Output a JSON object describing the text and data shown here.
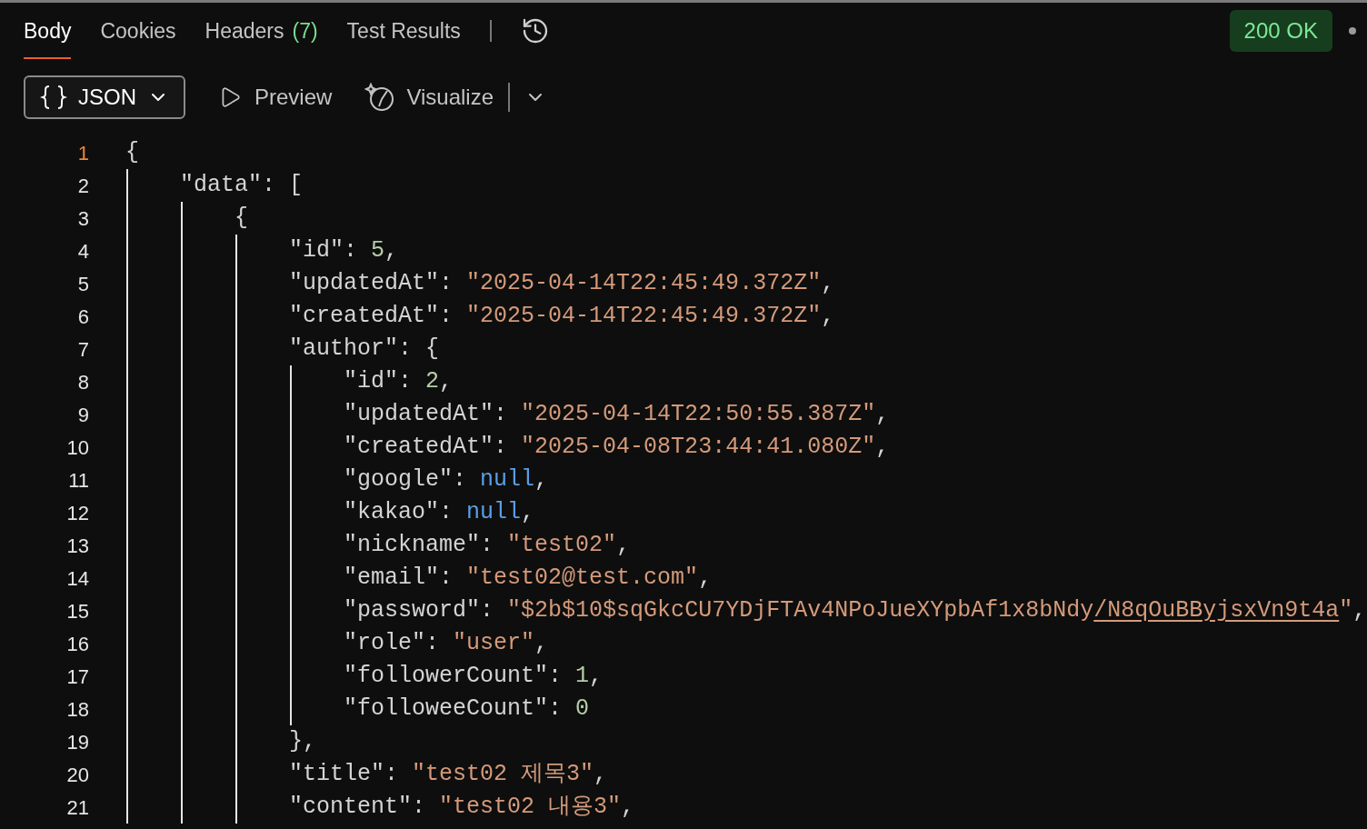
{
  "tabs": [
    {
      "label": "Body",
      "selected": true
    },
    {
      "label": "Cookies",
      "selected": false
    },
    {
      "label": "Headers",
      "count": "(7)",
      "selected": false
    },
    {
      "label": "Test Results",
      "selected": false
    }
  ],
  "status": {
    "text": "200 OK"
  },
  "toolbar": {
    "format": "JSON",
    "preview": "Preview",
    "visualize": "Visualize"
  },
  "code_lines": [
    {
      "number": "1",
      "current": true,
      "tokens": [
        {
          "kind": "punct",
          "text": "{"
        }
      ]
    },
    {
      "number": "2",
      "current": false,
      "tokens": [
        {
          "kind": "key",
          "text": "    \"data\""
        },
        {
          "kind": "punct",
          "text": ": ["
        }
      ]
    },
    {
      "number": "3",
      "current": false,
      "tokens": [
        {
          "kind": "punct",
          "text": "        {"
        }
      ]
    },
    {
      "number": "4",
      "current": false,
      "tokens": [
        {
          "kind": "key",
          "text": "            \"id\""
        },
        {
          "kind": "punct",
          "text": ": "
        },
        {
          "kind": "number",
          "text": "5"
        },
        {
          "kind": "punct",
          "text": ","
        }
      ]
    },
    {
      "number": "5",
      "current": false,
      "tokens": [
        {
          "kind": "key",
          "text": "            \"updatedAt\""
        },
        {
          "kind": "punct",
          "text": ": "
        },
        {
          "kind": "string",
          "text": "\"2025-04-14T22:45:49.372Z\""
        },
        {
          "kind": "punct",
          "text": ","
        }
      ]
    },
    {
      "number": "6",
      "current": false,
      "tokens": [
        {
          "kind": "key",
          "text": "            \"createdAt\""
        },
        {
          "kind": "punct",
          "text": ": "
        },
        {
          "kind": "string",
          "text": "\"2025-04-14T22:45:49.372Z\""
        },
        {
          "kind": "punct",
          "text": ","
        }
      ]
    },
    {
      "number": "7",
      "current": false,
      "tokens": [
        {
          "kind": "key",
          "text": "            \"author\""
        },
        {
          "kind": "punct",
          "text": ": {"
        }
      ]
    },
    {
      "number": "8",
      "current": false,
      "tokens": [
        {
          "kind": "key",
          "text": "                \"id\""
        },
        {
          "kind": "punct",
          "text": ": "
        },
        {
          "kind": "number",
          "text": "2"
        },
        {
          "kind": "punct",
          "text": ","
        }
      ]
    },
    {
      "number": "9",
      "current": false,
      "tokens": [
        {
          "kind": "key",
          "text": "                \"updatedAt\""
        },
        {
          "kind": "punct",
          "text": ": "
        },
        {
          "kind": "string",
          "text": "\"2025-04-14T22:50:55.387Z\""
        },
        {
          "kind": "punct",
          "text": ","
        }
      ]
    },
    {
      "number": "10",
      "current": false,
      "tokens": [
        {
          "kind": "key",
          "text": "                \"createdAt\""
        },
        {
          "kind": "punct",
          "text": ": "
        },
        {
          "kind": "string",
          "text": "\"2025-04-08T23:44:41.080Z\""
        },
        {
          "kind": "punct",
          "text": ","
        }
      ]
    },
    {
      "number": "11",
      "current": false,
      "tokens": [
        {
          "kind": "key",
          "text": "                \"google\""
        },
        {
          "kind": "punct",
          "text": ": "
        },
        {
          "kind": "null",
          "text": "null"
        },
        {
          "kind": "punct",
          "text": ","
        }
      ]
    },
    {
      "number": "12",
      "current": false,
      "tokens": [
        {
          "kind": "key",
          "text": "                \"kakao\""
        },
        {
          "kind": "punct",
          "text": ": "
        },
        {
          "kind": "null",
          "text": "null"
        },
        {
          "kind": "punct",
          "text": ","
        }
      ]
    },
    {
      "number": "13",
      "current": false,
      "tokens": [
        {
          "kind": "key",
          "text": "                \"nickname\""
        },
        {
          "kind": "punct",
          "text": ": "
        },
        {
          "kind": "string",
          "text": "\"test02\""
        },
        {
          "kind": "punct",
          "text": ","
        }
      ]
    },
    {
      "number": "14",
      "current": false,
      "tokens": [
        {
          "kind": "key",
          "text": "                \"email\""
        },
        {
          "kind": "punct",
          "text": ": "
        },
        {
          "kind": "string",
          "text": "\"test02@test.com\""
        },
        {
          "kind": "punct",
          "text": ","
        }
      ]
    },
    {
      "number": "15",
      "current": false,
      "tokens": [
        {
          "kind": "key",
          "text": "                \"password\""
        },
        {
          "kind": "punct",
          "text": ": "
        },
        {
          "kind": "string",
          "text": "\"$2b$10$sqGkcCU7YDjFTAv4NPoJueXYpbAf1x8bNdy"
        },
        {
          "kind": "link",
          "text": "/N8qOuBByjsxVn9t4a"
        },
        {
          "kind": "string",
          "text": "\""
        },
        {
          "kind": "punct",
          "text": ","
        }
      ]
    },
    {
      "number": "16",
      "current": false,
      "tokens": [
        {
          "kind": "key",
          "text": "                \"role\""
        },
        {
          "kind": "punct",
          "text": ": "
        },
        {
          "kind": "string",
          "text": "\"user\""
        },
        {
          "kind": "punct",
          "text": ","
        }
      ]
    },
    {
      "number": "17",
      "current": false,
      "tokens": [
        {
          "kind": "key",
          "text": "                \"followerCount\""
        },
        {
          "kind": "punct",
          "text": ": "
        },
        {
          "kind": "number",
          "text": "1"
        },
        {
          "kind": "punct",
          "text": ","
        }
      ]
    },
    {
      "number": "18",
      "current": false,
      "tokens": [
        {
          "kind": "key",
          "text": "                \"followeeCount\""
        },
        {
          "kind": "punct",
          "text": ": "
        },
        {
          "kind": "number",
          "text": "0"
        }
      ]
    },
    {
      "number": "19",
      "current": false,
      "tokens": [
        {
          "kind": "punct",
          "text": "            },"
        }
      ]
    },
    {
      "number": "20",
      "current": false,
      "tokens": [
        {
          "kind": "key",
          "text": "            \"title\""
        },
        {
          "kind": "punct",
          "text": ": "
        },
        {
          "kind": "string",
          "text": "\"test02 제목3\""
        },
        {
          "kind": "punct",
          "text": ","
        }
      ]
    },
    {
      "number": "21",
      "current": false,
      "tokens": [
        {
          "kind": "key",
          "text": "            \"content\""
        },
        {
          "kind": "punct",
          "text": ": "
        },
        {
          "kind": "string",
          "text": "\"test02 내용3\""
        },
        {
          "kind": "punct",
          "text": ","
        }
      ]
    }
  ]
}
